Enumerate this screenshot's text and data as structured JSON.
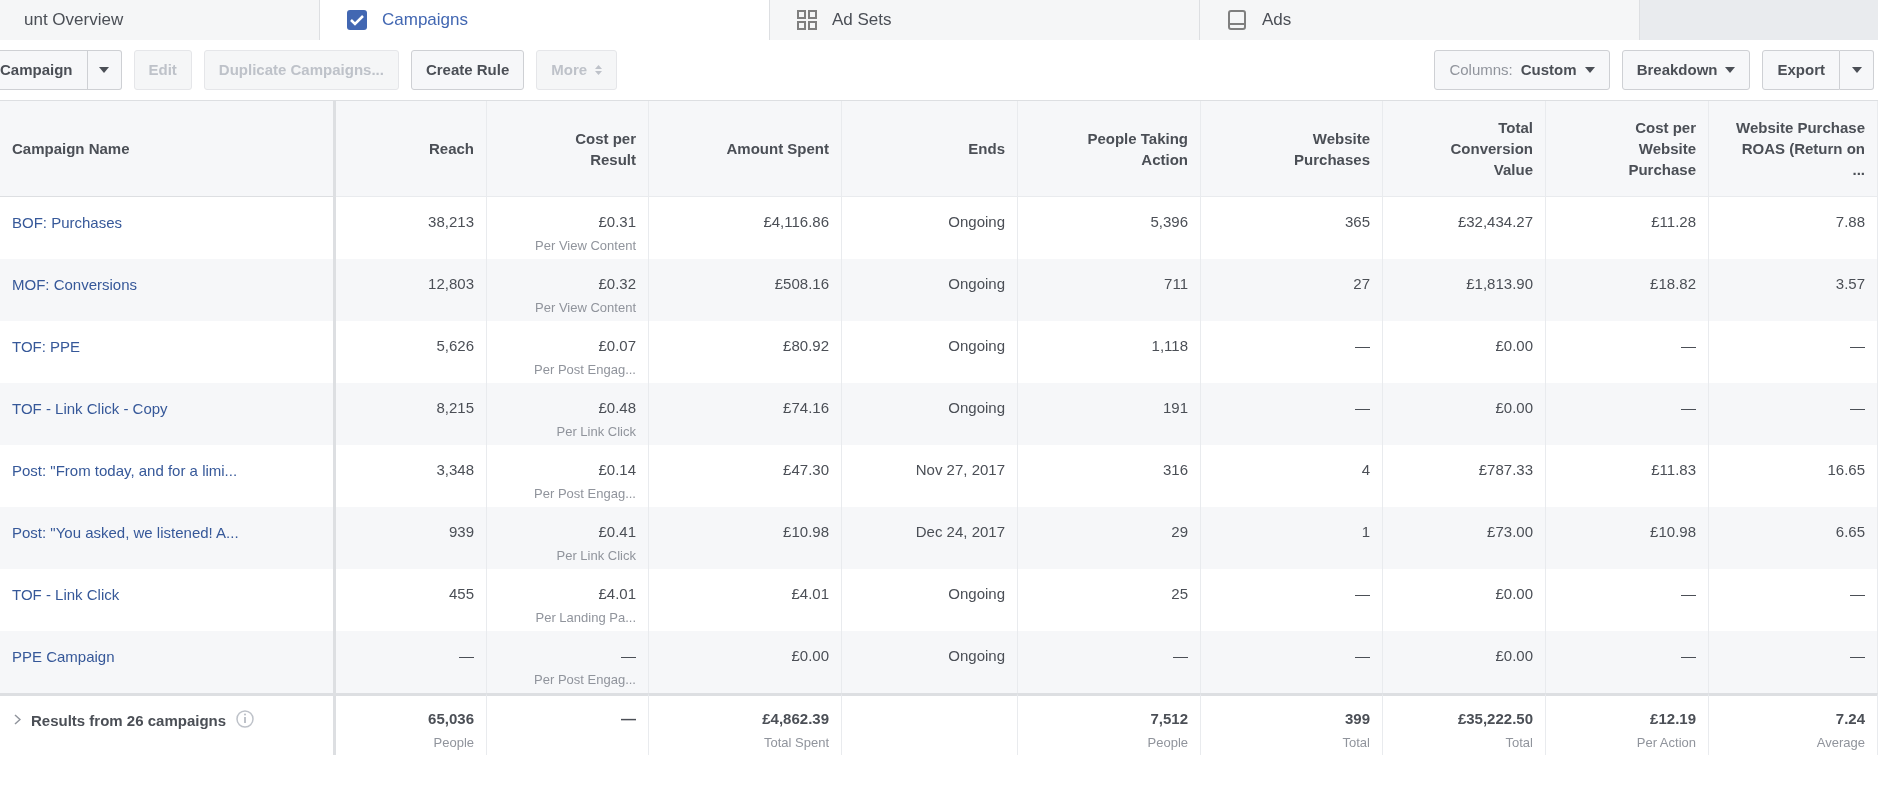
{
  "tabs": [
    {
      "label": "unt Overview",
      "kind": "plain",
      "selected": false
    },
    {
      "label": "Campaigns",
      "kind": "campaigns",
      "selected": true
    },
    {
      "label": "Ad Sets",
      "kind": "adsets",
      "selected": false
    },
    {
      "label": "Ads",
      "kind": "ads",
      "selected": false
    }
  ],
  "toolbar_left": [
    {
      "kind": "split",
      "label": "Campaign",
      "disabled": false
    },
    {
      "kind": "plain",
      "label": "Edit",
      "disabled": true
    },
    {
      "kind": "plain",
      "label": "Duplicate Campaigns...",
      "disabled": true
    },
    {
      "kind": "plain",
      "label": "Create Rule",
      "disabled": false
    },
    {
      "kind": "updown",
      "label": "More",
      "disabled": true
    }
  ],
  "toolbar_right": [
    {
      "kind": "dropdown",
      "prefix": "Columns:",
      "label": "Custom",
      "disabled": false
    },
    {
      "kind": "dropdown",
      "label": "Breakdown",
      "disabled": false
    },
    {
      "kind": "split",
      "label": "Export",
      "disabled": false
    }
  ],
  "table": {
    "columns": [
      "Campaign Name",
      "Reach",
      "Cost per Result",
      "Amount Spent",
      "Ends",
      "People Taking Action",
      "Website Purchases",
      "Total Conversion Value",
      "Cost per Website Purchase",
      "Website Purchase ROAS (Return on ..."
    ],
    "rows": [
      {
        "cells": [
          {
            "text": "BOF: Purchases"
          },
          {
            "text": "38,213"
          },
          {
            "text": "£0.31",
            "sub": "Per View Content"
          },
          {
            "text": "£4,116.86"
          },
          {
            "text": "Ongoing"
          },
          {
            "text": "5,396"
          },
          {
            "text": "365"
          },
          {
            "text": "£32,434.27"
          },
          {
            "text": "£11.28"
          },
          {
            "text": "7.88"
          }
        ]
      },
      {
        "cells": [
          {
            "text": "MOF: Conversions"
          },
          {
            "text": "12,803"
          },
          {
            "text": "£0.32",
            "sub": "Per View Content"
          },
          {
            "text": "£508.16"
          },
          {
            "text": "Ongoing"
          },
          {
            "text": "711"
          },
          {
            "text": "27"
          },
          {
            "text": "£1,813.90"
          },
          {
            "text": "£18.82"
          },
          {
            "text": "3.57"
          }
        ]
      },
      {
        "cells": [
          {
            "text": "TOF: PPE"
          },
          {
            "text": "5,626"
          },
          {
            "text": "£0.07",
            "sub": "Per Post Engag..."
          },
          {
            "text": "£80.92"
          },
          {
            "text": "Ongoing"
          },
          {
            "text": "1,118"
          },
          {
            "text": "—"
          },
          {
            "text": "£0.00"
          },
          {
            "text": "—"
          },
          {
            "text": "—"
          }
        ]
      },
      {
        "cells": [
          {
            "text": "TOF - Link Click - Copy"
          },
          {
            "text": "8,215"
          },
          {
            "text": "£0.48",
            "sub": "Per Link Click"
          },
          {
            "text": "£74.16"
          },
          {
            "text": "Ongoing"
          },
          {
            "text": "191"
          },
          {
            "text": "—"
          },
          {
            "text": "£0.00"
          },
          {
            "text": "—"
          },
          {
            "text": "—"
          }
        ]
      },
      {
        "cells": [
          {
            "text": "Post: \"From today, and for a limi..."
          },
          {
            "text": "3,348"
          },
          {
            "text": "£0.14",
            "sub": "Per Post Engag..."
          },
          {
            "text": "£47.30"
          },
          {
            "text": "Nov 27, 2017"
          },
          {
            "text": "316"
          },
          {
            "text": "4"
          },
          {
            "text": "£787.33"
          },
          {
            "text": "£11.83"
          },
          {
            "text": "16.65"
          }
        ]
      },
      {
        "cells": [
          {
            "text": "Post: \"You asked, we listened! A..."
          },
          {
            "text": "939"
          },
          {
            "text": "£0.41",
            "sub": "Per Link Click"
          },
          {
            "text": "£10.98"
          },
          {
            "text": "Dec 24, 2017"
          },
          {
            "text": "29"
          },
          {
            "text": "1"
          },
          {
            "text": "£73.00"
          },
          {
            "text": "£10.98"
          },
          {
            "text": "6.65"
          }
        ]
      },
      {
        "cells": [
          {
            "text": "TOF - Link Click"
          },
          {
            "text": "455"
          },
          {
            "text": "£4.01",
            "sub": "Per Landing Pa..."
          },
          {
            "text": "£4.01"
          },
          {
            "text": "Ongoing"
          },
          {
            "text": "25"
          },
          {
            "text": "—"
          },
          {
            "text": "£0.00"
          },
          {
            "text": "—"
          },
          {
            "text": "—"
          }
        ]
      },
      {
        "cells": [
          {
            "text": "PPE Campaign"
          },
          {
            "text": "—"
          },
          {
            "text": "—",
            "sub": "Per Post Engag..."
          },
          {
            "text": "£0.00"
          },
          {
            "text": "Ongoing"
          },
          {
            "text": "—"
          },
          {
            "text": "—"
          },
          {
            "text": "£0.00"
          },
          {
            "text": "—"
          },
          {
            "text": "—"
          }
        ]
      }
    ],
    "summary": {
      "cells": [
        {
          "text": "Results from 26 campaigns"
        },
        {
          "text": "65,036",
          "sub": "People"
        },
        {
          "text": "—"
        },
        {
          "text": "£4,862.39",
          "sub": "Total Spent"
        },
        {},
        {
          "text": "7,512",
          "sub": "People"
        },
        {
          "text": "399",
          "sub": "Total"
        },
        {
          "text": "£35,222.50",
          "sub": "Total"
        },
        {
          "text": "£12.19",
          "sub": "Per Action"
        },
        {
          "text": "7.24",
          "sub": "Average"
        }
      ]
    }
  }
}
